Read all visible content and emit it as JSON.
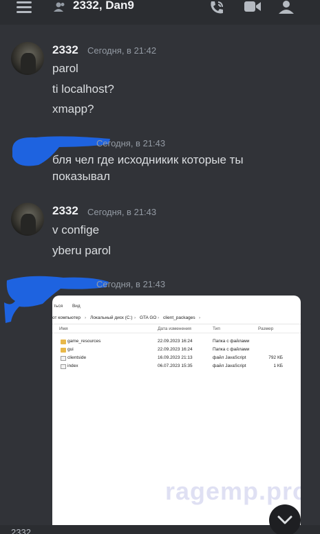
{
  "header": {
    "title": "2332, Dan9",
    "icons": [
      "menu-icon",
      "people-icon",
      "call-icon",
      "video-icon",
      "profile-icon"
    ]
  },
  "messages": [
    {
      "author": "2332",
      "timestamp": "Сегодня, в 21:42",
      "lines": [
        "parol",
        "ti localhost?",
        "xmapp?"
      ]
    },
    {
      "author": "",
      "timestamp": "Сегодня, в 21:43",
      "lines": [
        "бля чел где исходникик которые ты",
        "показывал"
      ]
    },
    {
      "author": "2332",
      "timestamp": "Сегодня, в 21:43",
      "lines": [
        "v confige",
        "yberu parol"
      ]
    },
    {
      "author": "",
      "timestamp": "Сегодня, в 21:43",
      "lines": []
    }
  ],
  "attachment": {
    "tabs": [
      "ться",
      "Вид"
    ],
    "breadcrumb": [
      "от компьютер",
      "Локальный диск (C:)",
      "GTA GO",
      "client_packages"
    ],
    "columns": [
      "Имя",
      "Дата изменения",
      "Тип",
      "Размер"
    ],
    "files": [
      {
        "name": "game_resources",
        "date": "22.09.2023 16:24",
        "type": "Папка с файлами",
        "size": "",
        "icon": "folder-icon"
      },
      {
        "name": "gui",
        "date": "22.09.2023 16:24",
        "type": "Папка с файлами",
        "size": "",
        "icon": "folder-icon"
      },
      {
        "name": "clientside",
        "date": "16.09.2023 21:13",
        "type": "файл JavaScript",
        "size": "792 КБ",
        "icon": "js-file-icon"
      },
      {
        "name": "index",
        "date": "06.07.2023 15:35",
        "type": "файл JavaScript",
        "size": "1 КБ",
        "icon": "js-file-icon"
      }
    ],
    "watermark": "ragemp.pro"
  },
  "footer": {
    "partial_author": "2332"
  },
  "colors": {
    "background": "#313338",
    "header": "#2b2d31",
    "scribble": "#1e63e0",
    "text": "#dbdee1",
    "muted": "#949ba4"
  }
}
